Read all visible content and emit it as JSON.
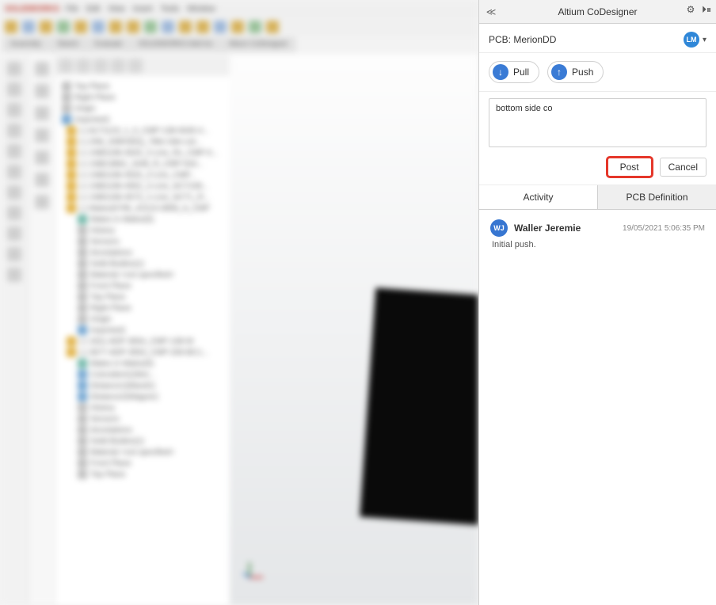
{
  "cad": {
    "app_name": "SOLIDWORKS",
    "menu": [
      "File",
      "Edit",
      "View",
      "Insert",
      "Tools",
      "Window"
    ],
    "tabs": [
      "Assembly",
      "Sketch",
      "Evaluate",
      "SOLIDWORKS Add-Ins",
      "Altium CoDesigner"
    ],
    "tree": {
      "planes": [
        "Top Plane",
        "Right Plane",
        "Origin",
        "Imported1"
      ],
      "parts": [
        "(-) ALT1123_1_0_CMP-138-0045-4...",
        "(-) 2N6_039HSEQ_786c-0de-Ltd...",
        "(-) 1NB1196-3520_2-Line_Rc_CMP-0...",
        "(-) 1NB13862_1648_R_CMP-043...",
        "(-) 1NB1196-4520_2-Line_CMP...",
        "(-) 1NB1196-4552_2-Line_ACT108...",
        "(-) 1NB1196-4573_1-Line_ACT1_R...",
        "(-) Mates(5795_4211S-0808_A_CMP"
      ],
      "sub1": [
        "Mates in Mates(5)",
        "History",
        "Sensors",
        "Annotations",
        "Solid Bodies(1)",
        "Material <not specified>",
        "Front Plane",
        "Top Plane",
        "Right Plane",
        "Origin",
        "Imported1"
      ],
      "parts2": [
        "(-) 1811-ADP-3554_CMP-138-W",
        "(-) 3677-ADP-3554_CMP-206-BC1..."
      ],
      "sub2": [
        "Mates in Mates(5)",
        "Coincident1(Wor...",
        "Distance1(Mand1)",
        "Distance2(Wagner)",
        "History",
        "Sensors",
        "Annotations",
        "Solid Bodies(1)",
        "Material <not specified>",
        "Front Plane",
        "Top Plane"
      ]
    }
  },
  "panel": {
    "title": "Altium CoDesigner",
    "pcb_label": "PCB:",
    "pcb_name": "MerionDD",
    "user_initials": "LM",
    "pull_label": "Pull",
    "push_label": "Push",
    "comment_value": "bottom side co",
    "post_label": "Post",
    "cancel_label": "Cancel",
    "tabs": {
      "activity": "Activity",
      "definition": "PCB Definition"
    },
    "activity": [
      {
        "avatar": "WJ",
        "user": "Waller Jeremie",
        "time": "19/05/2021 5:06:35 PM",
        "message": "Initial push."
      }
    ]
  }
}
